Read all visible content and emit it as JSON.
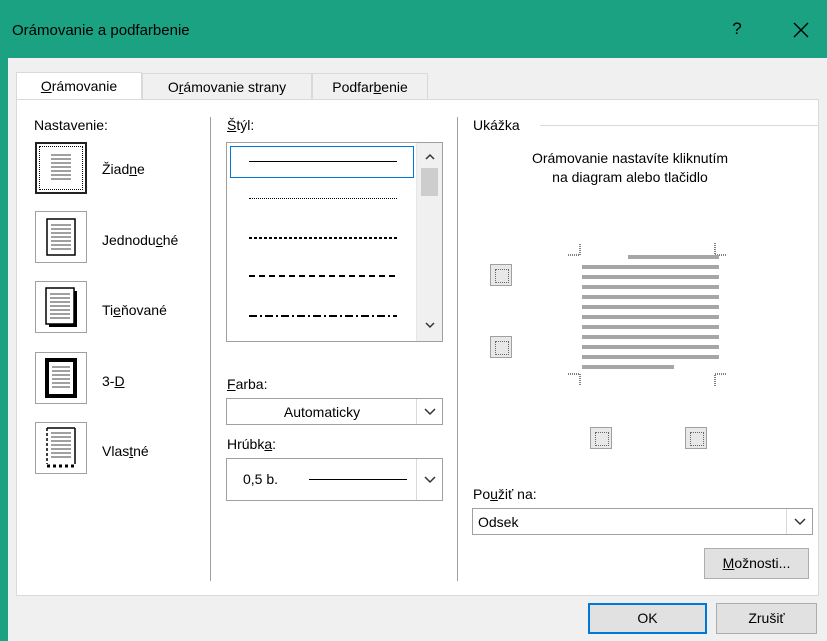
{
  "window": {
    "title": "Orámovanie a podfarbenie",
    "help": "?",
    "close": "✕"
  },
  "tabs": [
    {
      "pre": "",
      "u": "O",
      "post": "rámovanie"
    },
    {
      "pre": "O",
      "u": "r",
      "post": "ámovanie strany"
    },
    {
      "pre": "Podfar",
      "u": "b",
      "post": "enie"
    }
  ],
  "setting": {
    "label": "Nastavenie:",
    "items": [
      {
        "pre": "Žiad",
        "u": "n",
        "post": "e"
      },
      {
        "pre": "Jednodu",
        "u": "c",
        "post": "hé"
      },
      {
        "pre": "Ti",
        "u": "e",
        "post": "ňované"
      },
      {
        "pre": "3-",
        "u": "D",
        "post": ""
      },
      {
        "pre": "Vlas",
        "u": "t",
        "post": "né"
      }
    ]
  },
  "style": {
    "label_u": "Š",
    "label_post": "týl:",
    "items": [
      "solid",
      "dotted",
      "dashed-small",
      "dashed",
      "dash-dot"
    ]
  },
  "color": {
    "label_u": "F",
    "label_post": "arba:",
    "value": "Automaticky"
  },
  "width": {
    "label_pre": "Hrúbk",
    "label_u": "a",
    "label_post": ":",
    "value": "0,5 b."
  },
  "preview": {
    "label": "Ukážka",
    "instruction": "Orámovanie nastavíte kliknutím na diagram alebo tlačidlo"
  },
  "apply": {
    "label_pre": "Po",
    "label_u": "u",
    "label_post": "žiť na:",
    "value": "Odsek"
  },
  "buttons": {
    "options_u": "M",
    "options_post": "ožnosti...",
    "ok": "OK",
    "cancel": "Zrušiť"
  },
  "colors": {
    "titlebar": "#1aa282",
    "accent": "#0078d7"
  }
}
